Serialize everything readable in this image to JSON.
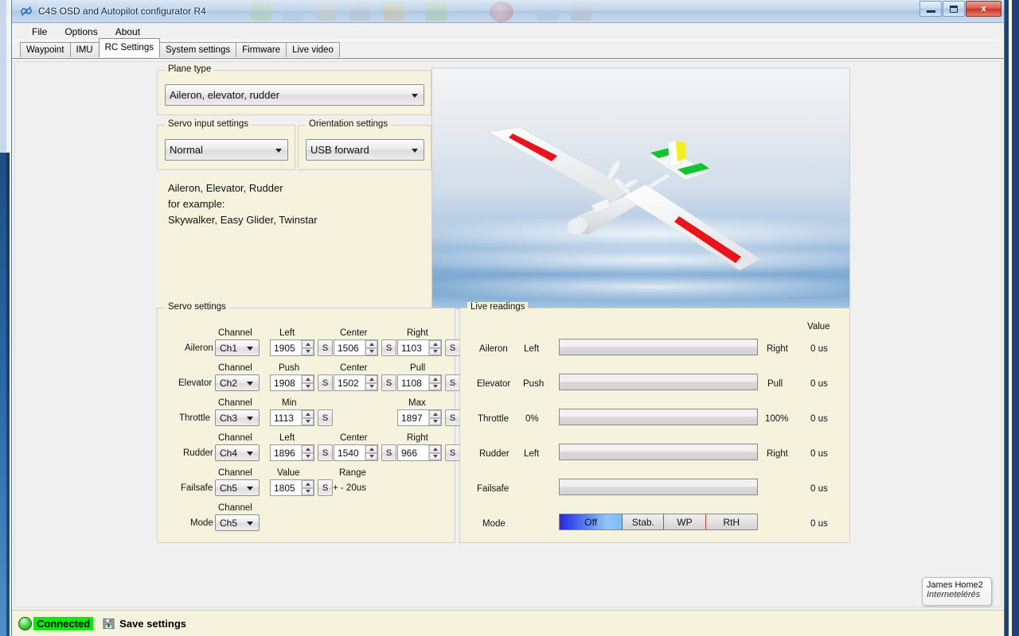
{
  "window": {
    "title": "C4S OSD and Autopilot configurator R4",
    "app_icon": "propeller-icon",
    "minimize_label": "Minimize",
    "maximize_label": "Maximize",
    "close_label": "x"
  },
  "menu": {
    "items": [
      {
        "label": "File"
      },
      {
        "label": "Options"
      },
      {
        "label": "About"
      }
    ]
  },
  "tabs": {
    "items": [
      {
        "label": "Waypoint",
        "active": false
      },
      {
        "label": "IMU",
        "active": false
      },
      {
        "label": "RC Settings",
        "active": true
      },
      {
        "label": "System settings",
        "active": false
      },
      {
        "label": "Firmware",
        "active": false
      },
      {
        "label": "Live video",
        "active": false
      }
    ]
  },
  "plane_type": {
    "group_title": "Plane type",
    "selected": "Aileron, elevator, rudder"
  },
  "servo_input": {
    "group_title": "Servo input settings",
    "selected": "Normal"
  },
  "orientation": {
    "group_title": "Orientation settings",
    "selected": "USB forward"
  },
  "description": {
    "line1": "Aileron, Elevator, Rudder",
    "line2": "for example:",
    "line3": "Skywalker, Easy Glider, Twinstar"
  },
  "plane_preview": {
    "name": "glider-3d-render",
    "wing_stripe_color": "#e8131b",
    "tail_fin_color": "#f2ef1e",
    "tail_plane_color": "#12c432"
  },
  "servo_settings": {
    "group_title": "Servo settings",
    "rows": [
      {
        "name": "Aileron",
        "headers": {
          "channel": "Channel",
          "col1": "Left",
          "col2": "Center",
          "col3": "Right"
        },
        "channel": "Ch1",
        "v1": "1905",
        "v2": "1506",
        "v3": "1103",
        "s_label": "S"
      },
      {
        "name": "Elevator",
        "headers": {
          "channel": "Channel",
          "col1": "Push",
          "col2": "Center",
          "col3": "Pull"
        },
        "channel": "Ch2",
        "v1": "1908",
        "v2": "1502",
        "v3": "1108",
        "s_label": "S"
      },
      {
        "name": "Throttle",
        "headers": {
          "channel": "Channel",
          "col1": "Min",
          "col2": "",
          "col3": "Max"
        },
        "channel": "Ch3",
        "v1": "1113",
        "v2": "",
        "v3": "1897",
        "s_label": "S"
      },
      {
        "name": "Rudder",
        "headers": {
          "channel": "Channel",
          "col1": "Left",
          "col2": "Center",
          "col3": "Right"
        },
        "channel": "Ch4",
        "v1": "1896",
        "v2": "1540",
        "v3": "966",
        "s_label": "S"
      },
      {
        "name": "Failsafe",
        "headers": {
          "channel": "Channel",
          "col1": "Value",
          "col2": "Range",
          "col3": ""
        },
        "channel": "Ch5",
        "v1": "1805",
        "v2": "",
        "v3": "",
        "range_text": "+ - 20us",
        "s_label": "S"
      },
      {
        "name": "Mode",
        "headers": {
          "channel": "Channel",
          "col1": "",
          "col2": "",
          "col3": ""
        },
        "channel": "Ch5",
        "v1": "",
        "v2": "",
        "v3": ""
      }
    ]
  },
  "live_readings": {
    "group_title": "Live readings",
    "value_header": "Value",
    "rows": [
      {
        "name": "Aileron",
        "left_label": "Left",
        "right_label": "Right",
        "value": "0 us",
        "fill_pct": 0
      },
      {
        "name": "Elevator",
        "left_label": "Push",
        "right_label": "Pull",
        "value": "0 us",
        "fill_pct": 0
      },
      {
        "name": "Throttle",
        "left_label": "0%",
        "right_label": "100%",
        "value": "0 us",
        "fill_pct": 0
      },
      {
        "name": "Rudder",
        "left_label": "Left",
        "right_label": "Right",
        "value": "0 us",
        "fill_pct": 0
      },
      {
        "name": "Failsafe",
        "left_label": "",
        "right_label": "",
        "value": "0 us",
        "fill_pct": 0
      }
    ],
    "mode_row": {
      "name": "Mode",
      "value": "0 us",
      "segments": [
        {
          "label": "Off",
          "active": true,
          "width_pct": 32
        },
        {
          "label": "Stab.",
          "active": false,
          "width_pct": 21
        },
        {
          "label": "WP",
          "active": false,
          "width_pct": 21
        },
        {
          "label": "RtH",
          "active": false,
          "width_pct": 26
        }
      ],
      "active_color": "#2a2ae0",
      "separator_color": "#e03a2a"
    }
  },
  "statusbar": {
    "connection_status": "Connected",
    "connection_color": "#00ee00",
    "save_label": "Save settings"
  },
  "network_tooltip": {
    "line1": "James Home2",
    "line2": "Internetelérés"
  }
}
